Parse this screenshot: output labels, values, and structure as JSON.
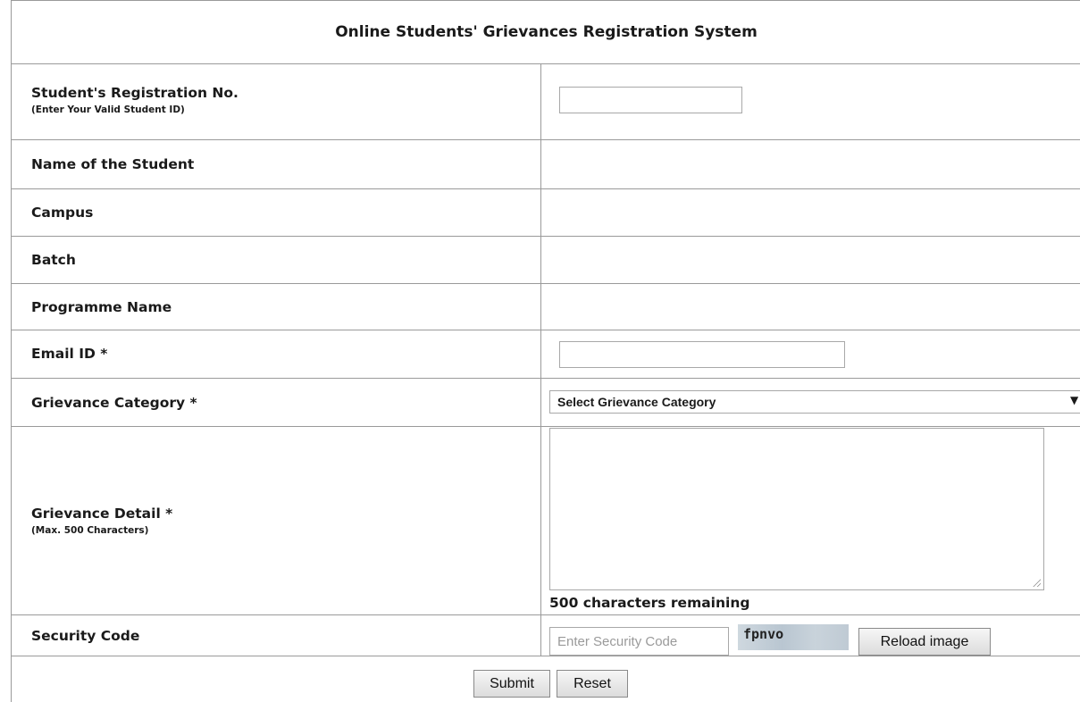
{
  "title": "Online Students' Grievances Registration System",
  "form": {
    "registration_label": "Student's Registration No.",
    "registration_hint": "(Enter Your Valid Student ID)",
    "registration_value": "",
    "name_label": "Name of the Student",
    "campus_label": "Campus",
    "batch_label": "Batch",
    "programme_label": "Programme Name",
    "email_label": "Email ID *",
    "email_value": "",
    "category_label": "Grievance Category *",
    "category_selected": "Select Grievance Category",
    "detail_label": "Grievance Detail *",
    "detail_hint": "(Max. 500 Characters)",
    "detail_value": "",
    "remaining_text": "500 characters remaining",
    "security_label": "Security Code",
    "security_placeholder": "Enter Security Code",
    "captcha_text": "fpnvo",
    "reload_label": "Reload image"
  },
  "actions": {
    "submit_label": "Submit",
    "reset_label": "Reset"
  },
  "icons": {
    "select_arrow": "chevron-down-icon",
    "resize_handle": "resize-grip-icon"
  }
}
